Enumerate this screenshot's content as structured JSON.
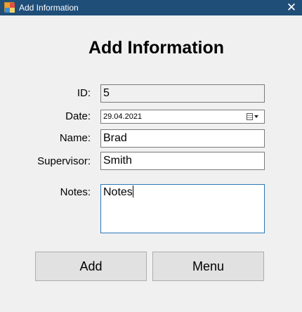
{
  "window": {
    "title": "Add Information",
    "close_symbol": "✕"
  },
  "form": {
    "heading": "Add Information",
    "id": {
      "label": "ID:",
      "value": "5"
    },
    "date": {
      "label": "Date:",
      "value": "29.04.2021"
    },
    "name": {
      "label": "Name:",
      "value": "Brad"
    },
    "supervisor": {
      "label": "Supervisor:",
      "value": "Smith"
    },
    "notes": {
      "label": "Notes:",
      "value": "Notes"
    }
  },
  "buttons": {
    "add": "Add",
    "menu": "Menu"
  },
  "colors": {
    "titlebar": "#1f4e79",
    "notes_border": "#2a78b8",
    "button_bg": "#e1e1e1"
  }
}
